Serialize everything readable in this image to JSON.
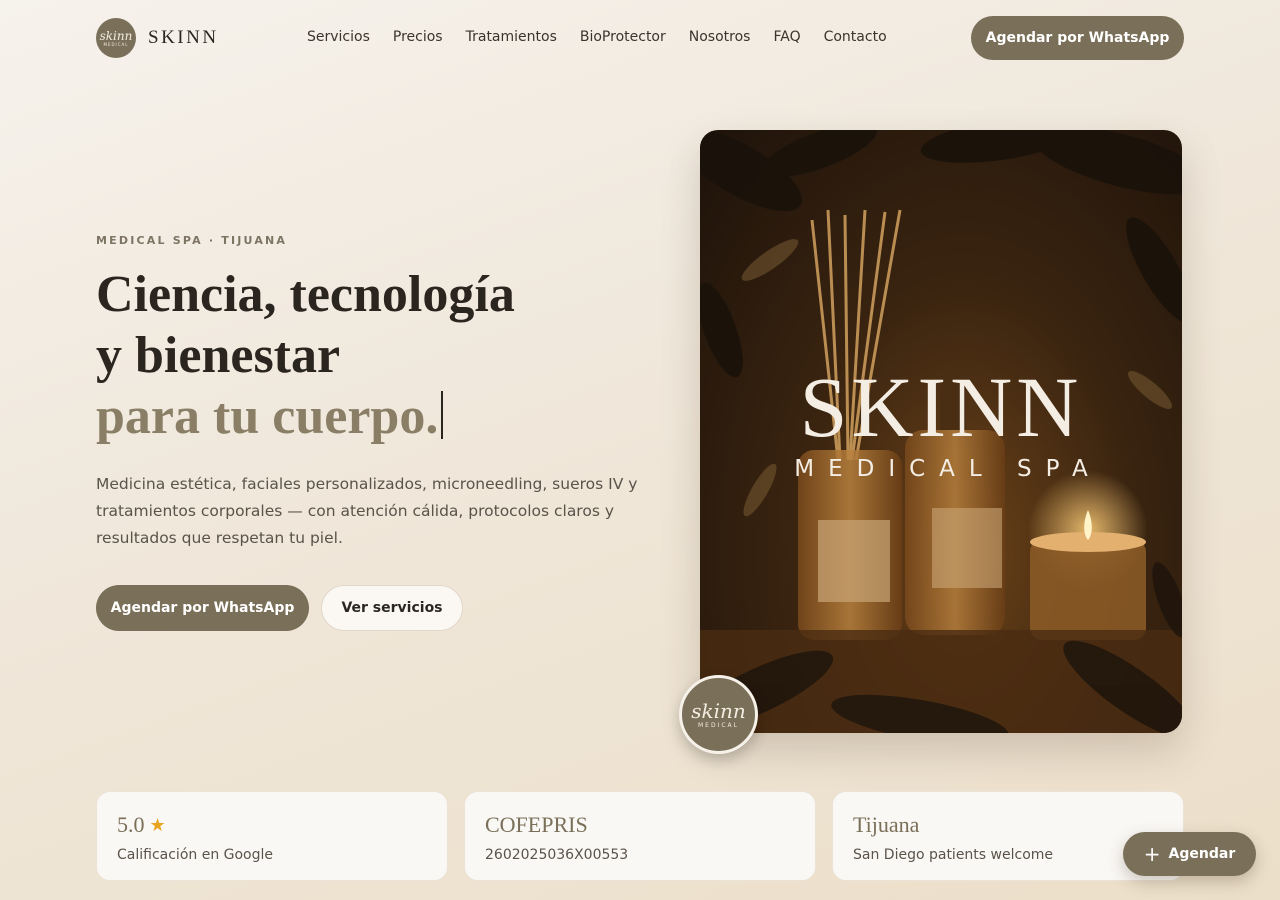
{
  "header": {
    "logo_mark_line1": "skinn",
    "logo_mark_line2": "MEDICAL",
    "brand": "SKINN",
    "nav": [
      "Servicios",
      "Precios",
      "Tratamientos",
      "BioProtector",
      "Nosotros",
      "FAQ",
      "Contacto"
    ],
    "cta": "Agendar por WhatsApp"
  },
  "hero": {
    "eyebrow": "MEDICAL SPA · TIJUANA",
    "headline_line1": "Ciencia, tecnología",
    "headline_line2": "y bienestar",
    "headline_accent": "para tu cuerpo.",
    "lead": "Medicina estética, faciales personalizados, microneedling, sueros IV y tratamientos corporales — con atención cálida, protocolos claros y resultados que respetan tu piel.",
    "primary_cta": "Agendar por WhatsApp",
    "secondary_cta": "Ver servicios"
  },
  "hero_image": {
    "title": "SKINN",
    "subtitle": "MEDICAL SPA"
  },
  "badge": {
    "line1": "skinn",
    "line2": "MEDICAL"
  },
  "stats": [
    {
      "value": "5.0",
      "icon": "star-icon",
      "label": "Calificación en Google"
    },
    {
      "value": "COFEPRIS",
      "label": "2602025036X00553"
    },
    {
      "value": "Tijuana",
      "label": "San Diego patients welcome"
    }
  ],
  "fab": {
    "label": "Agendar",
    "icon": "plus-icon"
  },
  "colors": {
    "brand": "#7a6f58",
    "accent_text": "#8a7f66",
    "star": "#e8a41e",
    "background": "#f3ece1"
  }
}
